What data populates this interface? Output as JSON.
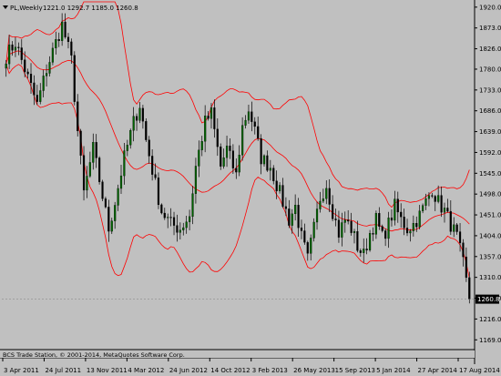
{
  "header": {
    "symbol": "PL,Weekly",
    "ohlc": "1221.0 1292.7 1185.0 1260.8"
  },
  "footer": {
    "copyright": "BCS Trade Station, © 2001-2014, MetaQuotes Software Corp."
  },
  "colors": {
    "background": "#c0c0c0",
    "bull_candle": "#006400",
    "bear_candle": "#000000",
    "bollinger": "#ff0000",
    "grid": "#aaaaaa",
    "axis": "#000000"
  },
  "chart_data": {
    "type": "candlestick",
    "title": "",
    "indicator": "Bollinger Bands",
    "ylim": [
      1149,
      1932
    ],
    "y_ticks": [
      1920.0,
      1873.0,
      1826.0,
      1780.0,
      1733.0,
      1686.0,
      1639.0,
      1592.0,
      1545.0,
      1498.0,
      1451.0,
      1404.0,
      1357.0,
      1310.0,
      1263.0,
      1216.0,
      1169.0
    ],
    "y_tick_labels": [
      "1920.0",
      "1873.0",
      "1826.0",
      "1780.0",
      "1733.0",
      "1686.0",
      "1639.0",
      "1592.0",
      "1545.0",
      "1498.0",
      "1451.0",
      "1404.0",
      "1357.0",
      "1310.0",
      "1263.0",
      "1216.0",
      "1169.0"
    ],
    "x_labels": [
      "3 Apr 2011",
      "24 Jul 2011",
      "13 Nov 2011",
      "4 Mar 2012",
      "24 Jun 2012",
      "14 Oct 2012",
      "3 Feb 2013",
      "26 May 2013",
      "15 Sep 2013",
      "5 Jan 2014",
      "27 Apr 2014",
      "17 Aug 2014"
    ],
    "current_price": 1260.8,
    "current_price_label": "1260.8",
    "close_anchors": [
      {
        "week": 0,
        "close": 1810
      },
      {
        "week": 3,
        "close": 1840
      },
      {
        "week": 7,
        "close": 1760
      },
      {
        "week": 10,
        "close": 1700
      },
      {
        "week": 13,
        "close": 1780
      },
      {
        "week": 16,
        "close": 1840
      },
      {
        "week": 18,
        "close": 1880
      },
      {
        "week": 21,
        "close": 1800
      },
      {
        "week": 23,
        "close": 1640
      },
      {
        "week": 25,
        "close": 1500
      },
      {
        "week": 28,
        "close": 1600
      },
      {
        "week": 30,
        "close": 1530
      },
      {
        "week": 33,
        "close": 1420
      },
      {
        "week": 35,
        "close": 1480
      },
      {
        "week": 38,
        "close": 1580
      },
      {
        "week": 41,
        "close": 1660
      },
      {
        "week": 43,
        "close": 1700
      },
      {
        "week": 45,
        "close": 1620
      },
      {
        "week": 48,
        "close": 1520
      },
      {
        "week": 50,
        "close": 1460
      },
      {
        "week": 53,
        "close": 1430
      },
      {
        "week": 56,
        "close": 1420
      },
      {
        "week": 59,
        "close": 1450
      },
      {
        "week": 61,
        "close": 1560
      },
      {
        "week": 64,
        "close": 1660
      },
      {
        "week": 66,
        "close": 1680
      },
      {
        "week": 69,
        "close": 1560
      },
      {
        "week": 71,
        "close": 1600
      },
      {
        "week": 74,
        "close": 1540
      },
      {
        "week": 76,
        "close": 1650
      },
      {
        "week": 78,
        "close": 1690
      },
      {
        "week": 80,
        "close": 1640
      },
      {
        "week": 82,
        "close": 1580
      },
      {
        "week": 85,
        "close": 1560
      },
      {
        "week": 88,
        "close": 1500
      },
      {
        "week": 91,
        "close": 1440
      },
      {
        "week": 93,
        "close": 1470
      },
      {
        "week": 95,
        "close": 1400
      },
      {
        "week": 97,
        "close": 1350
      },
      {
        "week": 99,
        "close": 1420
      },
      {
        "week": 101,
        "close": 1490
      },
      {
        "week": 103,
        "close": 1520
      },
      {
        "week": 105,
        "close": 1460
      },
      {
        "week": 107,
        "close": 1410
      },
      {
        "week": 109,
        "close": 1440
      },
      {
        "week": 111,
        "close": 1420
      },
      {
        "week": 113,
        "close": 1380
      },
      {
        "week": 115,
        "close": 1360
      },
      {
        "week": 117,
        "close": 1410
      },
      {
        "week": 119,
        "close": 1440
      },
      {
        "week": 121,
        "close": 1400
      },
      {
        "week": 123,
        "close": 1430
      },
      {
        "week": 125,
        "close": 1470
      },
      {
        "week": 127,
        "close": 1440
      },
      {
        "week": 129,
        "close": 1420
      },
      {
        "week": 131,
        "close": 1430
      },
      {
        "week": 133,
        "close": 1450
      },
      {
        "week": 135,
        "close": 1480
      },
      {
        "week": 137,
        "close": 1510
      },
      {
        "week": 139,
        "close": 1480
      },
      {
        "week": 141,
        "close": 1460
      },
      {
        "week": 143,
        "close": 1430
      },
      {
        "week": 145,
        "close": 1400
      },
      {
        "week": 147,
        "close": 1340
      },
      {
        "week": 149,
        "close": 1260
      }
    ]
  }
}
